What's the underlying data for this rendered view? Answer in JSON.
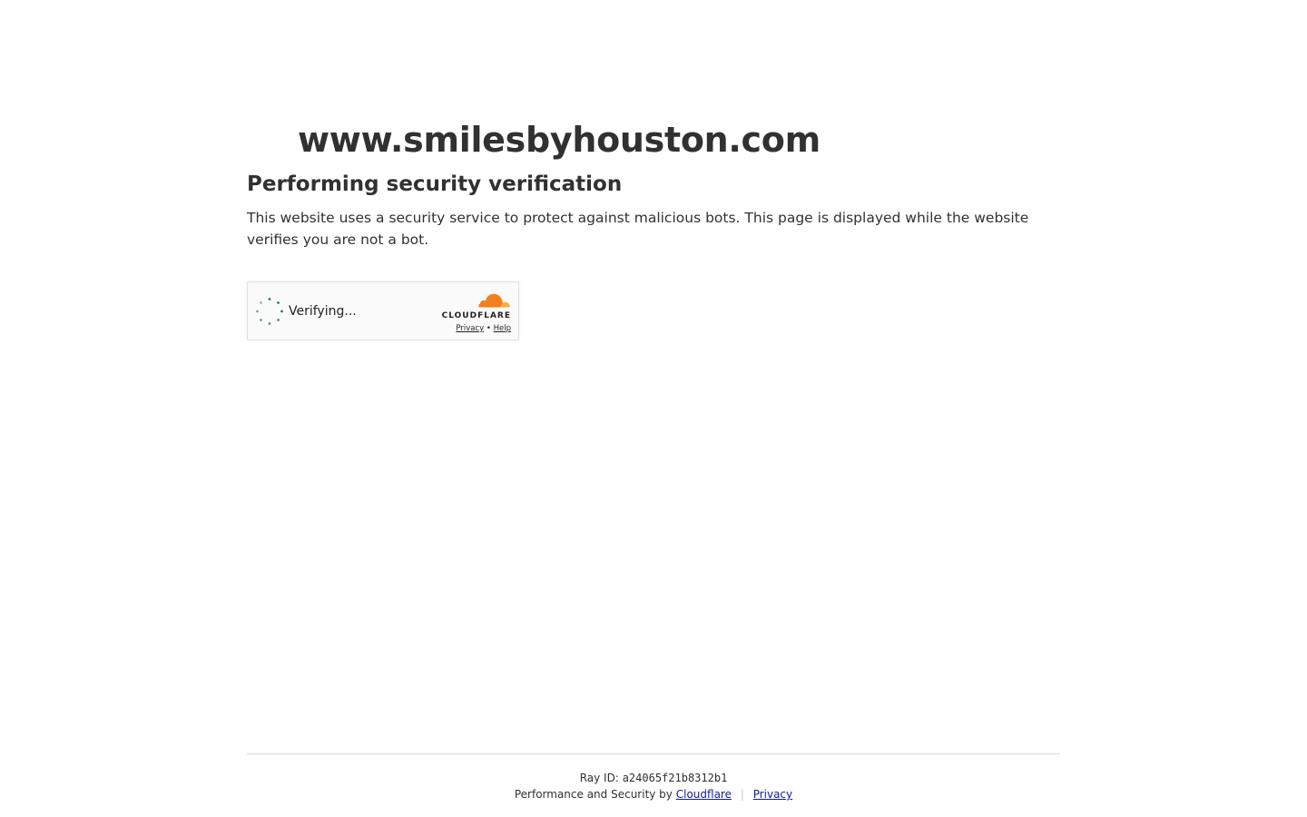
{
  "site": {
    "domain": "www.smilesbyhouston.com"
  },
  "main": {
    "heading": "Performing security verification",
    "description": "This website uses a security service to protect against malicious bots. This page is displayed while the website verifies you are not a bot."
  },
  "widget": {
    "status_text": "Verifying...",
    "brand_name": "CLOUDFLARE",
    "privacy_link": "Privacy",
    "link_separator": "•",
    "help_link": "Help",
    "spinner_icon": "loading-spinner-icon",
    "brand_icon": "cloudflare-cloud-icon",
    "spinner_color": "#2c7a5a",
    "brand_color_primary": "#f38020",
    "brand_color_secondary": "#faae40"
  },
  "footer": {
    "ray_label": "Ray ID:",
    "ray_id": "a24065f21b8312b1",
    "performance_prefix": "Performance and Security by",
    "cloudflare_link": "Cloudflare",
    "divider": "|",
    "privacy_link": "Privacy",
    "link_color": "#0f1b9e"
  }
}
